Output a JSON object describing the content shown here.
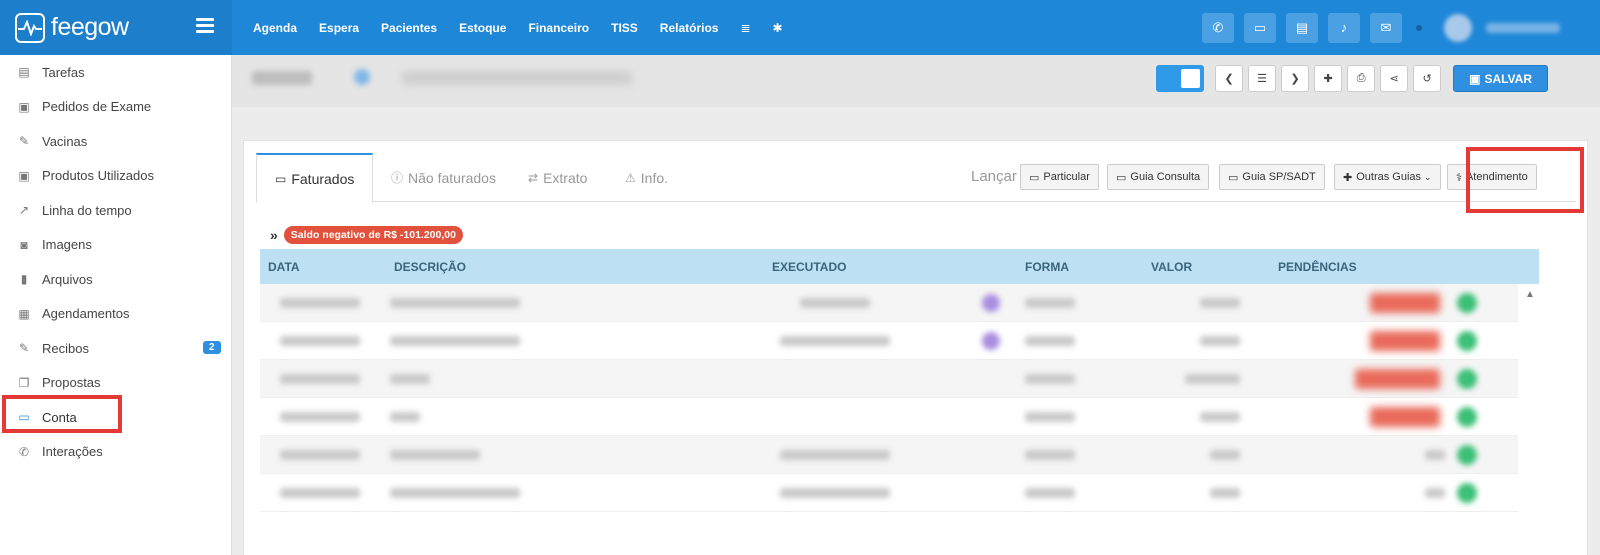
{
  "brand": {
    "name": "feegow"
  },
  "topnav": [
    "Agenda",
    "Espera",
    "Pacientes",
    "Estoque",
    "Financeiro",
    "TISS",
    "Relatórios"
  ],
  "sidebar": {
    "items": [
      {
        "label": "Tarefas",
        "icon": "clipboard-icon",
        "glyph": "▤"
      },
      {
        "label": "Pedidos de Exame",
        "icon": "clipboard-check-icon",
        "glyph": "📋"
      },
      {
        "label": "Vacinas",
        "icon": "syringe-icon",
        "glyph": "✎"
      },
      {
        "label": "Produtos Utilizados",
        "icon": "box-icon",
        "glyph": "▣"
      },
      {
        "label": "Linha do tempo",
        "icon": "line-chart-icon",
        "glyph": "↗"
      },
      {
        "label": "Imagens",
        "icon": "camera-icon",
        "glyph": "◙"
      },
      {
        "label": "Arquivos",
        "icon": "file-icon",
        "glyph": "▮"
      },
      {
        "label": "Agendamentos",
        "icon": "calendar-icon",
        "glyph": "▦"
      },
      {
        "label": "Recibos",
        "icon": "edit-icon",
        "glyph": "✎",
        "badge": "2"
      },
      {
        "label": "Propostas",
        "icon": "copy-icon",
        "glyph": "❐"
      },
      {
        "label": "Conta",
        "icon": "money-icon",
        "glyph": "▭"
      },
      {
        "label": "Interações",
        "icon": "phone-icon",
        "glyph": "✆"
      }
    ]
  },
  "header": {
    "save_label": "SALVAR"
  },
  "tabs": [
    {
      "label": "Faturados",
      "glyph": "▭"
    },
    {
      "label": "Não faturados",
      "glyph": "ⓘ"
    },
    {
      "label": "Extrato",
      "glyph": "⇄"
    },
    {
      "label": "Info.",
      "glyph": "⚠"
    }
  ],
  "launch": {
    "label": "Lançar",
    "buttons": [
      "Particular",
      "Guia Consulta",
      "Guia SP/SADT",
      "Outras Guias",
      "Atendimento"
    ]
  },
  "balance": {
    "raquo": "»",
    "text": "Saldo negativo de R$ -101.200,00"
  },
  "table": {
    "columns": [
      "DATA",
      "DESCRIÇÃO",
      "EXECUTADO",
      "FORMA",
      "VALOR",
      "PENDÊNCIAS"
    ]
  },
  "colors": {
    "topbar": "#1f87d8",
    "accent": "#2f8fe0",
    "highlight": "#e53935",
    "alert": "#e2513b",
    "table_head": "#bde1f3"
  }
}
